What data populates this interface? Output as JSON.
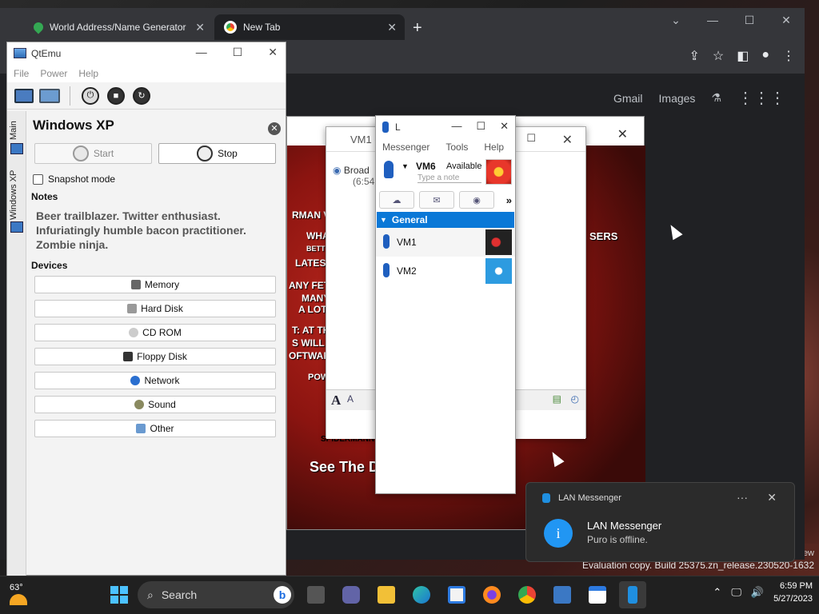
{
  "chrome": {
    "tabs": [
      {
        "title": "World Address/Name Generator"
      },
      {
        "title": "New Tab"
      }
    ],
    "ntp_links": [
      "Gmail",
      "Images"
    ]
  },
  "qtemu": {
    "title": "QtEmu",
    "menu": [
      "File",
      "Power",
      "Help"
    ],
    "side_tabs": [
      "Main",
      "Windows XP"
    ],
    "vm_name": "Windows XP",
    "start_label": "Start",
    "stop_label": "Stop",
    "snapshot_label": "Snapshot mode",
    "notes_label": "Notes",
    "notes_text": "Beer trailblazer. Twitter enthusiast. Infuriatingly humble bacon practitioner. Zombie ninja.",
    "devices_label": "Devices",
    "devices": [
      {
        "label": "Memory",
        "icon": "memory-icon"
      },
      {
        "label": "Hard Disk",
        "icon": "hard-disk-icon"
      },
      {
        "label": "CD ROM",
        "icon": "cd-rom-icon"
      },
      {
        "label": "Floppy Disk",
        "icon": "floppy-disk-icon"
      },
      {
        "label": "Network",
        "icon": "network-icon"
      },
      {
        "label": "Sound",
        "icon": "sound-icon"
      },
      {
        "label": "Other",
        "icon": "other-icon"
      }
    ]
  },
  "chat": {
    "title": "VM1 -",
    "entry_name": "Broad",
    "entry_time": "(6:54"
  },
  "lan": {
    "title": "L",
    "menu": [
      "Messenger",
      "Tools",
      "Help"
    ],
    "user_name": "VM6",
    "status": "Available",
    "note_placeholder": "Type a note",
    "group": "General",
    "contacts": [
      {
        "name": "VM1"
      },
      {
        "name": "VM2"
      }
    ]
  },
  "background": {
    "lines": [
      "RMAN V",
      "WHA",
      "BETT",
      "LATEST",
      "ANY FETUR",
      "MANY",
      "A LOT",
      "T: AT TH",
      "S WILL T",
      "OFTWAR",
      "POW",
      "SPIDERMANN",
      "See The De",
      "SERS"
    ]
  },
  "toast": {
    "app": "LAN Messenger",
    "heading": "LAN Messenger",
    "message": "Puro is offline."
  },
  "desktop": {
    "watermark": "Evaluation copy. Build 25375.zn_release.230520-1632",
    "watermark_edge": "ew"
  },
  "taskbar": {
    "weather_temp": "63°",
    "search_placeholder": "Search",
    "time": "6:59 PM",
    "date": "5/27/2023"
  },
  "colors": {
    "accent_blue": "#0a78d7",
    "taskbar": "#202020",
    "chrome_dark": "#35363a"
  }
}
